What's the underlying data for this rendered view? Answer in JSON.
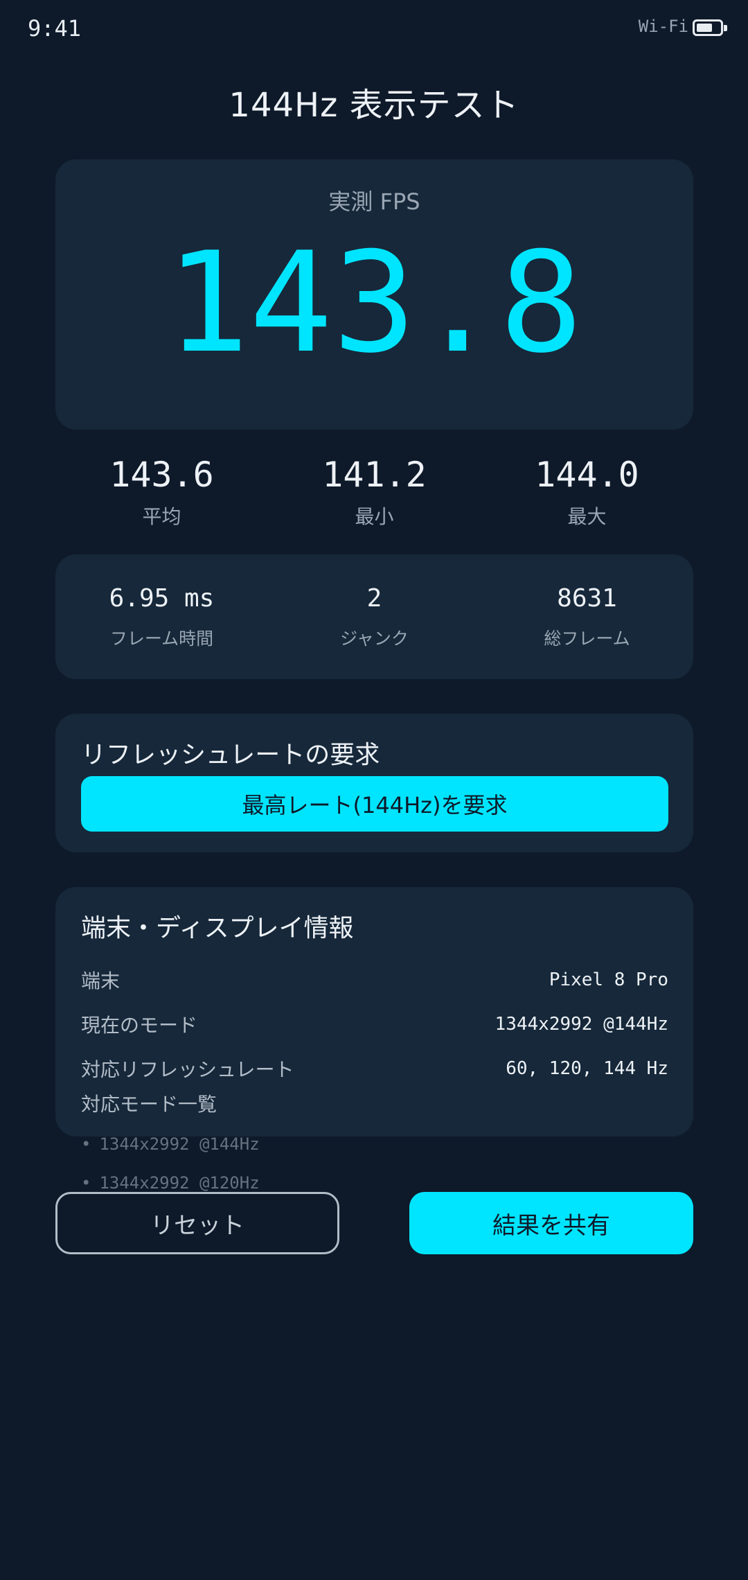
{
  "status_bar": {
    "time": "9:41",
    "wifi": "Wi-Fi",
    "battery_level": 0.7
  },
  "page_title": "144Hz 表示テスト",
  "fps": {
    "label": "実測 FPS",
    "value": "143.8"
  },
  "stats": [
    {
      "value": "143.6",
      "label": "平均"
    },
    {
      "value": "141.2",
      "label": "最小"
    },
    {
      "value": "144.0",
      "label": "最大"
    }
  ],
  "frame_stats": [
    {
      "value": "6.95 ms",
      "label": "フレーム時間"
    },
    {
      "value": "2",
      "label": "ジャンク"
    },
    {
      "value": "8631",
      "label": "総フレーム"
    }
  ],
  "refresh_request": {
    "title": "リフレッシュレートの要求",
    "button_label": "最高レート(144Hz)を要求"
  },
  "device_info": {
    "title": "端末・ディスプレイ情報",
    "rows": [
      {
        "label": "端末",
        "value": "Pixel 8 Pro"
      },
      {
        "label": "現在のモード",
        "value": "1344x2992 @144Hz"
      },
      {
        "label": "対応リフレッシュレート",
        "value": "60, 120, 144 Hz"
      }
    ],
    "modes_title": "対応モード一覧",
    "modes": [
      "1344x2992 @144Hz",
      "1344x2992 @120Hz"
    ]
  },
  "actions": {
    "reset_label": "リセット",
    "share_label": "結果を共有"
  },
  "colors": {
    "background": "#0e1a2a",
    "card": "#16283a",
    "accent": "#00e5ff"
  }
}
